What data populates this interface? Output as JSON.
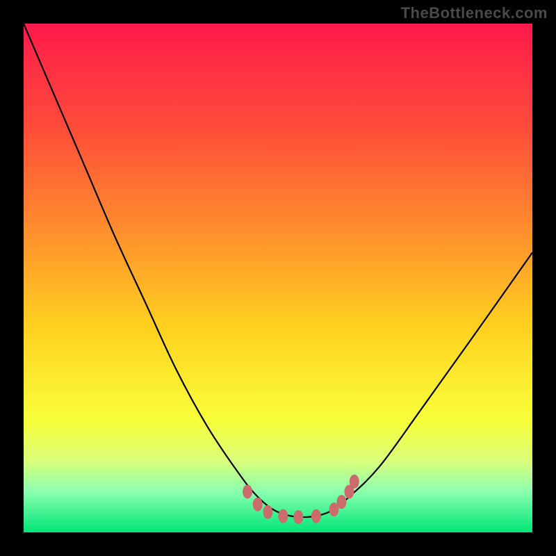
{
  "watermark": "TheBottleneck.com",
  "chart_data": {
    "type": "line",
    "title": "",
    "xlabel": "",
    "ylabel": "",
    "xlim": [
      0,
      100
    ],
    "ylim": [
      0,
      100
    ],
    "background_gradient_stops": [
      {
        "offset": 0.0,
        "color": "#ff1a4b"
      },
      {
        "offset": 0.2,
        "color": "#ff4b3a"
      },
      {
        "offset": 0.4,
        "color": "#ff8c2e"
      },
      {
        "offset": 0.6,
        "color": "#ffd21f"
      },
      {
        "offset": 0.78,
        "color": "#f8ff3a"
      },
      {
        "offset": 0.86,
        "color": "#d9ff7a"
      },
      {
        "offset": 0.92,
        "color": "#8affb0"
      },
      {
        "offset": 1.0,
        "color": "#00e676"
      }
    ],
    "series": [
      {
        "name": "bottleneck-curve",
        "x": [
          0.0,
          6.0,
          12.0,
          18.0,
          24.0,
          30.0,
          36.0,
          42.0,
          46.0,
          50.0,
          55.0,
          60.0,
          64.0,
          70.0,
          78.0,
          88.0,
          100.0
        ],
        "y": [
          100.0,
          86.0,
          72.0,
          58.0,
          45.0,
          32.0,
          21.0,
          12.0,
          7.0,
          4.0,
          3.0,
          4.0,
          7.0,
          13.0,
          24.0,
          38.0,
          55.0
        ]
      }
    ],
    "markers": {
      "name": "bottom-dots",
      "color": "#cc6b6b",
      "points": [
        {
          "x": 44.0,
          "y": 8.0
        },
        {
          "x": 46.0,
          "y": 5.5
        },
        {
          "x": 48.0,
          "y": 4.0
        },
        {
          "x": 51.0,
          "y": 3.2
        },
        {
          "x": 54.0,
          "y": 3.0
        },
        {
          "x": 57.5,
          "y": 3.2
        },
        {
          "x": 61.0,
          "y": 4.5
        },
        {
          "x": 62.5,
          "y": 6.0
        },
        {
          "x": 64.0,
          "y": 8.0
        },
        {
          "x": 65.0,
          "y": 10.0
        }
      ]
    }
  }
}
